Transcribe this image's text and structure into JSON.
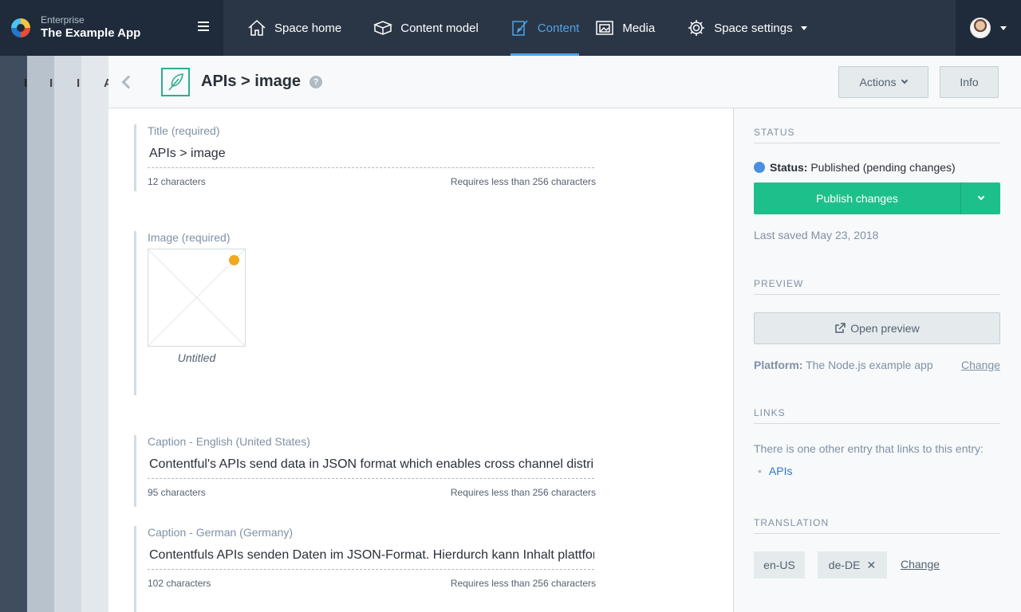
{
  "org": {
    "plan": "Enterprise",
    "name": "The Example App"
  },
  "nav": {
    "items": [
      {
        "label": "Space home",
        "icon": "home-icon"
      },
      {
        "label": "Content model",
        "icon": "content-model-icon"
      },
      {
        "label": "Content",
        "icon": "content-icon",
        "active": true
      },
      {
        "label": "Media",
        "icon": "media-icon"
      },
      {
        "label": "Space settings",
        "icon": "gear-icon"
      }
    ]
  },
  "stack_letters": [
    "I",
    "I",
    "I",
    "A"
  ],
  "entry": {
    "title": "APIs > image",
    "actions_label": "Actions",
    "info_label": "Info"
  },
  "fields": {
    "title": {
      "label": "Title (required)",
      "value": "APIs > image",
      "count": "12 characters",
      "limit": "Requires less than 256 characters"
    },
    "image": {
      "label": "Image (required)",
      "asset_title": "Untitled"
    },
    "caption_en": {
      "label": "Caption - English (United States)",
      "value": "Contentful's APIs send data in JSON format which enables cross channel distribution",
      "count": "95 characters",
      "limit": "Requires less than 256 characters"
    },
    "caption_de": {
      "label": "Caption - German (Germany)",
      "value": "Contentfuls APIs senden Daten im JSON-Format. Hierdurch kann Inhalt plattformübergreifend",
      "count": "102 characters",
      "limit": "Requires less than 256 characters"
    }
  },
  "sidebar": {
    "status": {
      "title": "STATUS",
      "label": "Status:",
      "value": "Published (pending changes)",
      "publish_label": "Publish changes",
      "last_saved": "Last saved May 23, 2018"
    },
    "preview": {
      "title": "PREVIEW",
      "button": "Open preview",
      "platform_label": "Platform:",
      "platform_value": "The Node.js example app",
      "change": "Change"
    },
    "links": {
      "title": "LINKS",
      "text": "There is one other entry that links to this entry:",
      "items": [
        "APIs"
      ]
    },
    "translation": {
      "title": "TRANSLATION",
      "locales": [
        "en-US",
        "de-DE"
      ],
      "change": "Change"
    }
  },
  "colors": {
    "nav_bg": "#2a3646",
    "accent": "#4ea3e6",
    "publish": "#1dc08a",
    "status_dot": "#4a90e2",
    "pending_dot": "#f0a91c"
  }
}
